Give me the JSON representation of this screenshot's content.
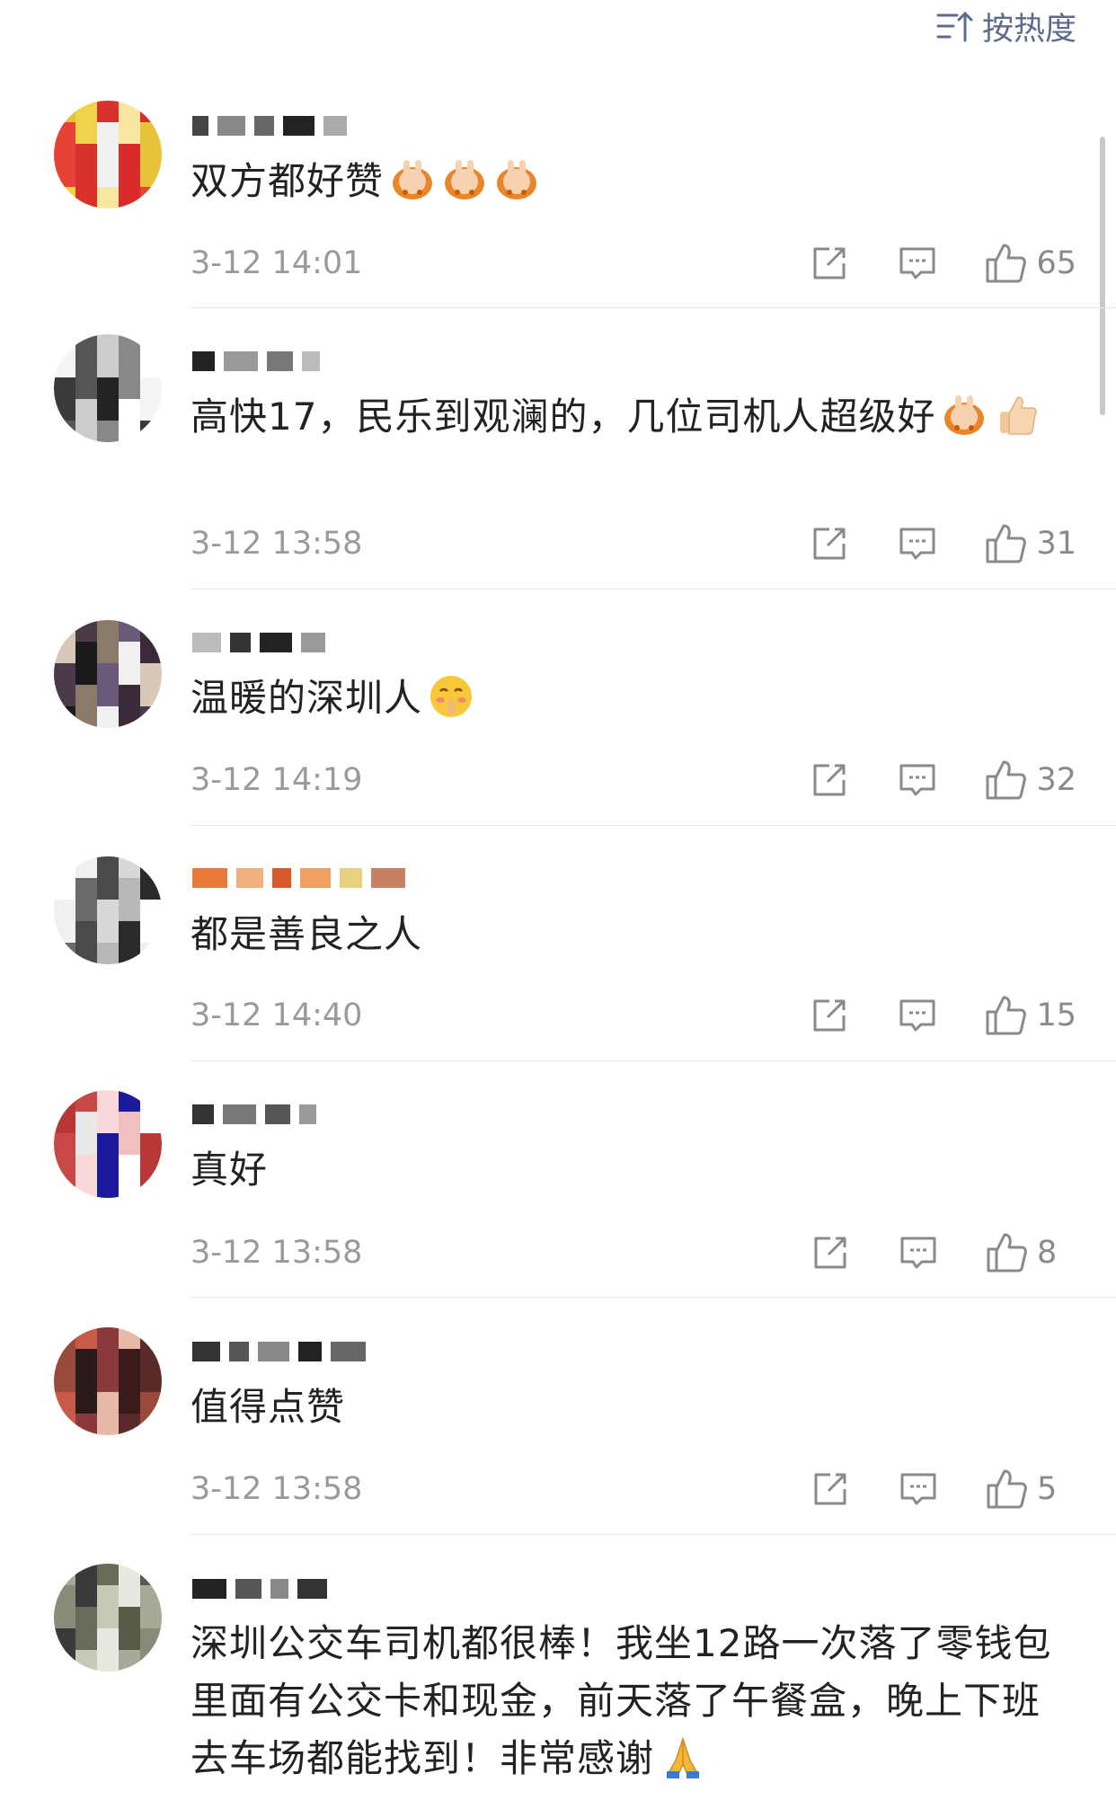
{
  "sort": {
    "label": "按热度",
    "icon": "sort-icon"
  },
  "colors": {
    "accent": "#5f6b8a",
    "text": "#222222",
    "meta": "#9a9a9a",
    "divider": "#e8e8e8"
  },
  "comments": [
    {
      "text": "双方都好赞",
      "emojis": [
        "clap-emoji",
        "clap-emoji",
        "clap-emoji"
      ],
      "time": "3-12 14:01",
      "likes": "65"
    },
    {
      "text": "高快17，民乐到观澜的，几位司机人超级好",
      "emojis": [
        "clap-emoji",
        "thumbs-up-emoji"
      ],
      "time": "3-12 13:58",
      "likes": "31"
    },
    {
      "text": "温暖的深圳人",
      "emojis": [
        "shy-face-emoji"
      ],
      "time": "3-12 14:19",
      "likes": "32"
    },
    {
      "text": "都是善良之人",
      "emojis": [],
      "time": "3-12 14:40",
      "likes": "15"
    },
    {
      "text": "真好",
      "emojis": [],
      "time": "3-12 13:58",
      "likes": "8"
    },
    {
      "text": "值得点赞",
      "emojis": [],
      "time": "3-12 13:58",
      "likes": "5"
    },
    {
      "text": "深圳公交车司机都很棒！我坐12路一次落了零钱包里面有公交卡和现金，前天落了午餐盒，晚上下班去车场都能找到！非常感谢",
      "emojis": [
        "pray-emoji"
      ],
      "time": "",
      "likes": ""
    }
  ]
}
